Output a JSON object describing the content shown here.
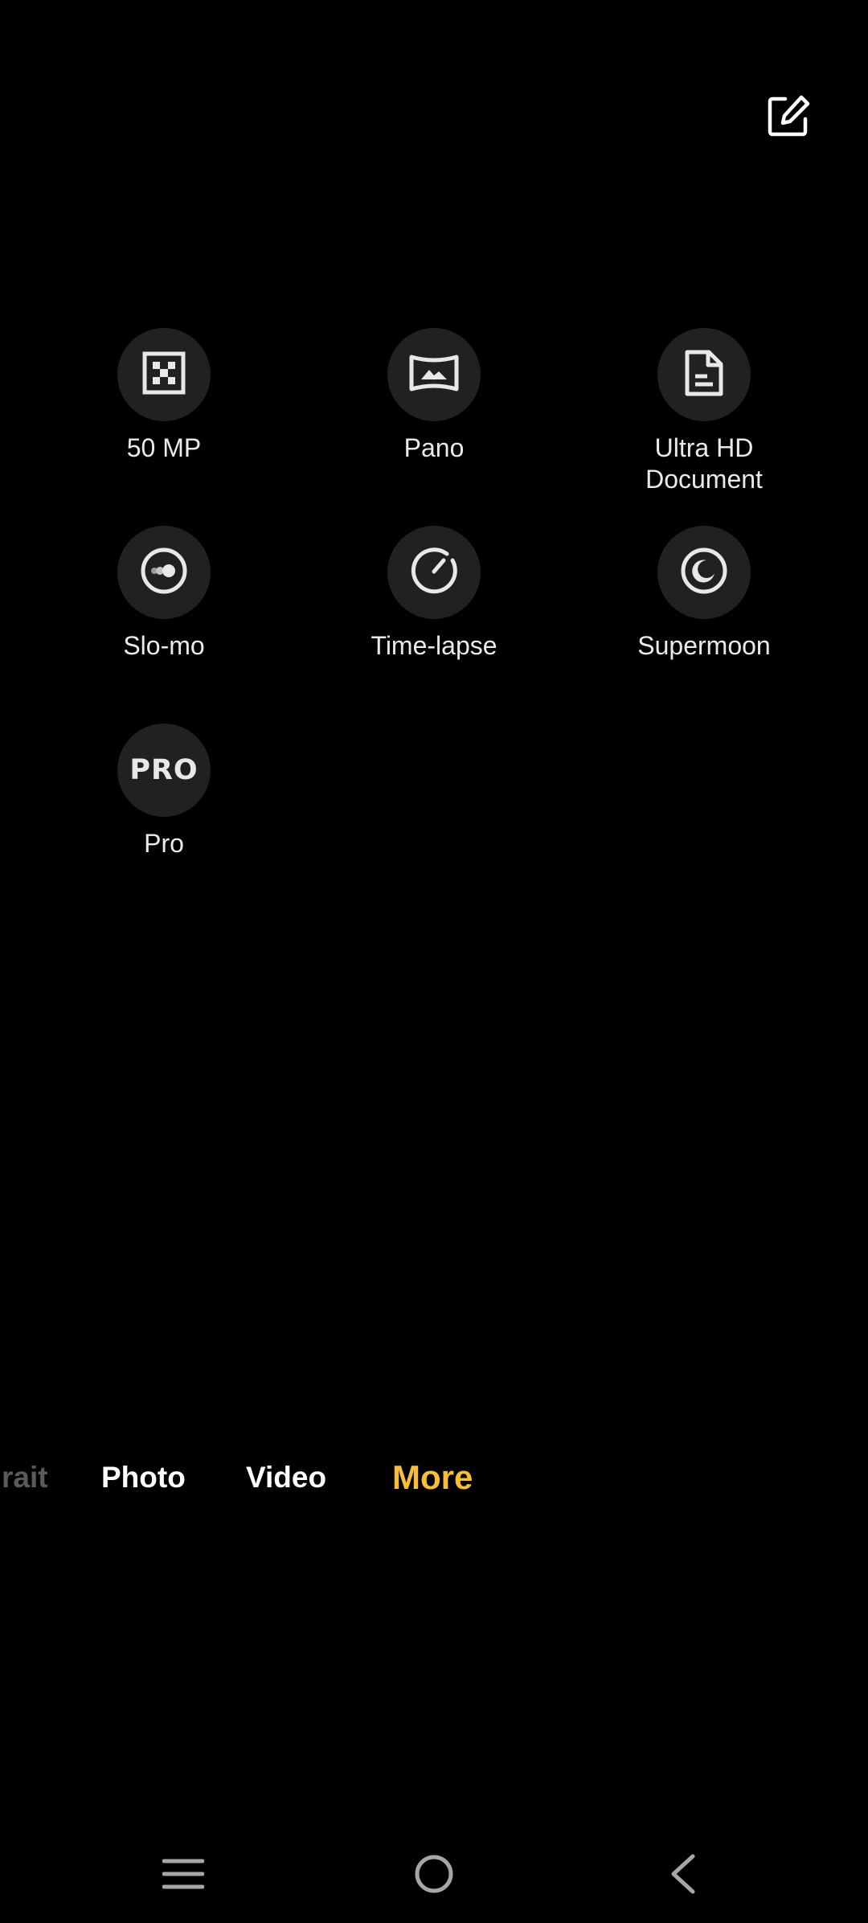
{
  "toolbar": {
    "edit_icon": "edit-square-icon"
  },
  "modes": [
    {
      "label": "50 MP",
      "icon": "high-res-grid-icon"
    },
    {
      "label": "Pano",
      "icon": "panorama-icon"
    },
    {
      "label": "Ultra HD\nDocument",
      "icon": "document-icon"
    },
    {
      "label": "Slo-mo",
      "icon": "slow-motion-icon"
    },
    {
      "label": "Time-lapse",
      "icon": "timelapse-icon"
    },
    {
      "label": "Supermoon",
      "icon": "moon-icon"
    },
    {
      "label": "Pro",
      "icon_text": "PRO",
      "icon": "pro-text-icon"
    }
  ],
  "mode_strip": {
    "items": [
      {
        "label": "rait",
        "state": "cut-off"
      },
      {
        "label": "Photo",
        "state": "normal"
      },
      {
        "label": "Video",
        "state": "normal"
      },
      {
        "label": "More",
        "state": "selected"
      }
    ],
    "selected_color": "#f7c034"
  },
  "navbar": {
    "menu_icon": "menu-icon",
    "home_icon": "home-icon",
    "back_icon": "back-icon"
  }
}
